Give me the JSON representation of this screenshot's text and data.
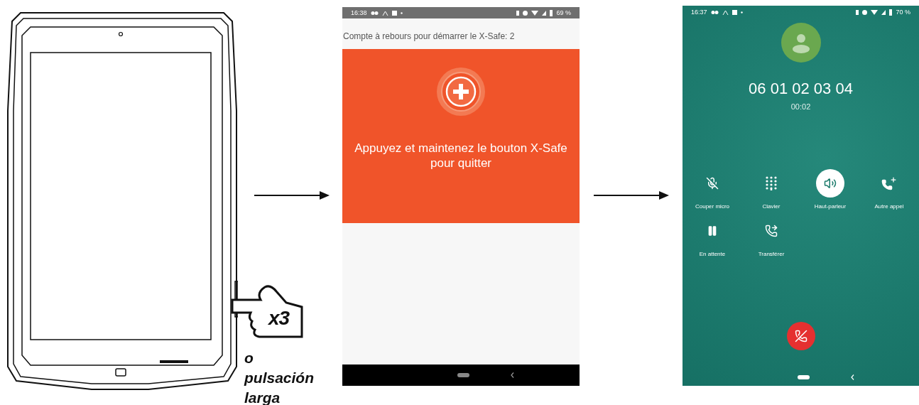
{
  "gesture": {
    "count": "x3",
    "caption": "o pulsación larga"
  },
  "xsafe_screen": {
    "status_bar": {
      "time": "16:38",
      "battery": "69 %"
    },
    "countdown": "Compte à rebours pour démarrer le X-Safe: 2",
    "message": "Appuyez et maintenez le bouton X-Safe pour quitter"
  },
  "call_screen": {
    "status_bar": {
      "time": "16:37",
      "battery": "70 %"
    },
    "number": "06 01 02 03 04",
    "duration": "00:02",
    "actions": [
      {
        "kind": "mute",
        "label": "Couper micro",
        "selected": false
      },
      {
        "kind": "dialpad",
        "label": "Clavier",
        "selected": false
      },
      {
        "kind": "speaker",
        "label": "Haut-parleur",
        "selected": true
      },
      {
        "kind": "add-call",
        "label": "Autre appel",
        "selected": false
      },
      {
        "kind": "hold",
        "label": "En attente",
        "selected": false
      },
      {
        "kind": "transfer",
        "label": "Transférer",
        "selected": false
      }
    ]
  }
}
